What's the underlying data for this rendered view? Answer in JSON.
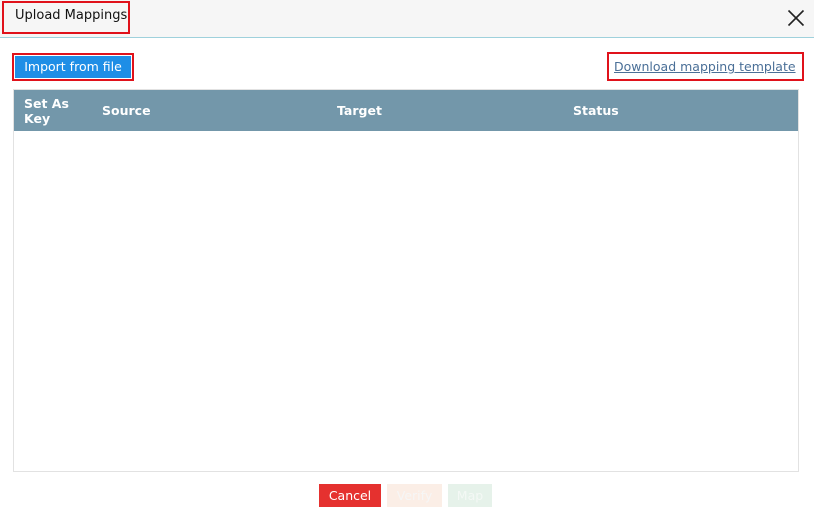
{
  "dialog": {
    "title": "Upload Mappings",
    "close_icon": "close-icon"
  },
  "toolbar": {
    "import_label": "Import from file",
    "download_label": "Download mapping template"
  },
  "table": {
    "columns": [
      "Set As Key",
      "Source",
      "Target",
      "Status"
    ],
    "rows": []
  },
  "footer": {
    "cancel_label": "Cancel",
    "verify_label": "Verify",
    "map_label": "Map"
  },
  "colors": {
    "header_bg": "#7397aa",
    "import_button": "#1e8ee6",
    "cancel_button": "#e5312f",
    "highlight_border": "#e0121b",
    "link": "#4a6f97"
  }
}
